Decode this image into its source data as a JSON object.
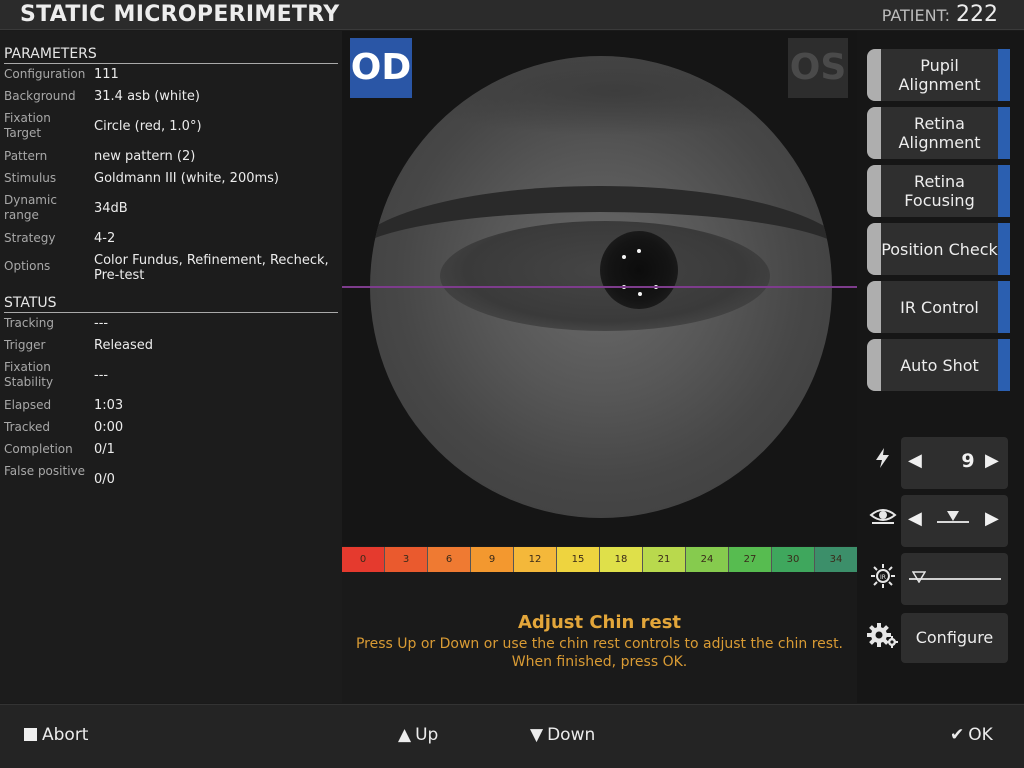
{
  "header": {
    "title": "STATIC MICROPERIMETRY",
    "patient_label": "PATIENT:",
    "patient_id": "222"
  },
  "parameters": {
    "title": "PARAMETERS",
    "rows": [
      {
        "label": "Configuration",
        "value": "111"
      },
      {
        "label": "Background",
        "value": "31.4 asb (white)"
      },
      {
        "label": "Fixation Target",
        "value": "Circle (red, 1.0°)"
      },
      {
        "label": "Pattern",
        "value": "new pattern (2)"
      },
      {
        "label": "Stimulus",
        "value": "Goldmann III (white, 200ms)"
      },
      {
        "label": "Dynamic range",
        "value": "34dB"
      },
      {
        "label": "Strategy",
        "value": "4-2"
      },
      {
        "label": "Options",
        "value": "Color Fundus, Refinement, Recheck, Pre-test"
      }
    ]
  },
  "status": {
    "title": "STATUS",
    "rows": [
      {
        "label": "Tracking",
        "value": "---"
      },
      {
        "label": "Trigger",
        "value": "Released"
      },
      {
        "label": "Fixation Stability",
        "value": "---"
      },
      {
        "label": "Elapsed",
        "value": "1:03"
      },
      {
        "label": "Tracked",
        "value": "0:00"
      },
      {
        "label": "Completion",
        "value": "0/1"
      },
      {
        "label": "False positive",
        "value": "0/0"
      }
    ]
  },
  "eye": {
    "od_label": "OD",
    "os_label": "OS",
    "line_color": "#7d3c8c"
  },
  "scale": {
    "labels": [
      "0",
      "3",
      "6",
      "9",
      "12",
      "15",
      "18",
      "21",
      "24",
      "27",
      "30",
      "34"
    ],
    "colors": [
      "#e53a2e",
      "#ea5a2e",
      "#ef7a32",
      "#f3982f",
      "#f4b83a",
      "#eed43f",
      "#dfe04a",
      "#b9d94d",
      "#86cb4e",
      "#57bc50",
      "#3fa75d",
      "#3c8f6a"
    ]
  },
  "message": {
    "title": "Adjust Chin rest",
    "body": "Press Up or Down or use the chin rest controls to adjust the chin rest. When finished, press OK."
  },
  "right_buttons": [
    {
      "label": "Pupil Alignment"
    },
    {
      "label": "Retina Alignment"
    },
    {
      "label": "Retina Focusing"
    },
    {
      "label": "Position Check"
    },
    {
      "label": "IR Control"
    },
    {
      "label": "Auto Shot"
    }
  ],
  "controls": {
    "flash_value": "9",
    "flash_icon": "lightning-icon",
    "eye_icon": "eye-icon",
    "ir_icon": "ir-sun-icon",
    "gear_icon": "gear-icon",
    "configure_label": "Configure",
    "eye_slider_level": 0.5,
    "ir_slider_level": 0.1
  },
  "footer": {
    "abort": "Abort",
    "up": "Up",
    "down": "Down",
    "ok": "OK"
  },
  "colors": {
    "accent_blue": "#2b5fb0",
    "message_orange": "#e3a63a"
  }
}
